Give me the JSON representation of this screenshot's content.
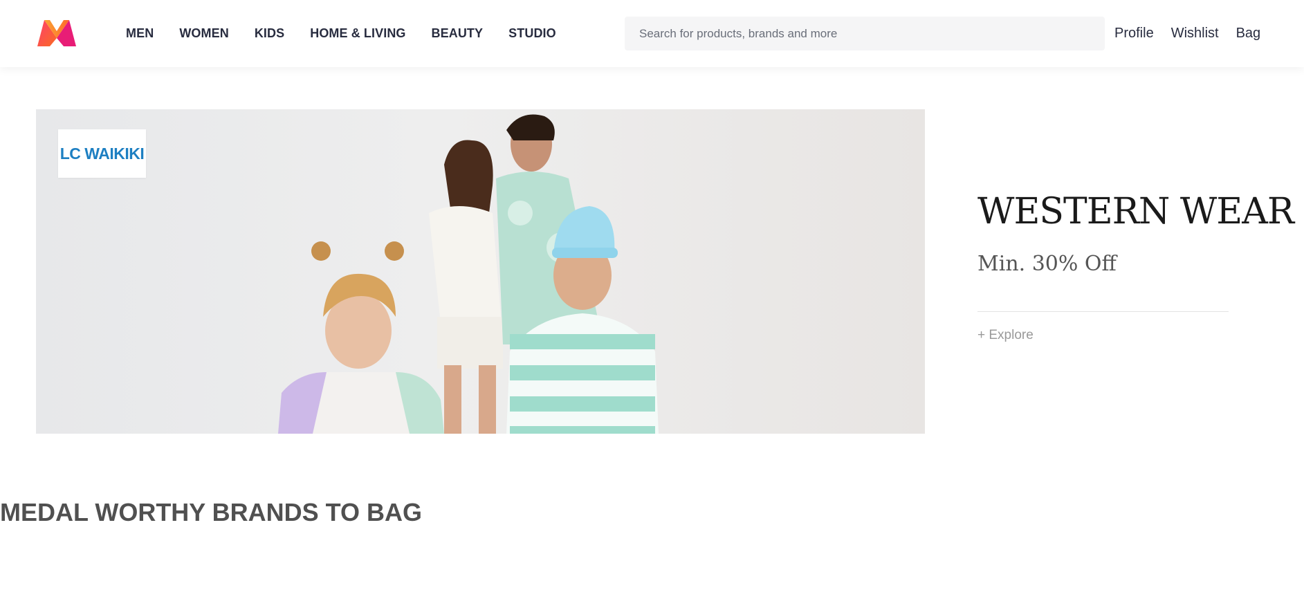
{
  "header": {
    "logo_icon": "myntra-logo-icon",
    "nav": [
      "MEN",
      "WOMEN",
      "KIDS",
      "HOME & LIVING",
      "BEAUTY",
      "STUDIO"
    ],
    "search": {
      "placeholder": "Search for products, brands and more",
      "value": ""
    },
    "actions": [
      "Profile",
      "Wishlist",
      "Bag"
    ]
  },
  "banner": {
    "brand_logo_text": "LC WAIKIKI",
    "image": "family-in-western-wear-photo"
  },
  "promo": {
    "title": "WESTERN WEAR",
    "subtitle": "Min. 30% Off",
    "cta": "+ Explore"
  },
  "section": {
    "title": "MEDAL WORTHY BRANDS TO BAG"
  },
  "colors": {
    "brand_pink": "#ff3f6c",
    "brand_orange": "#f9a433",
    "text": "#282c3f"
  }
}
